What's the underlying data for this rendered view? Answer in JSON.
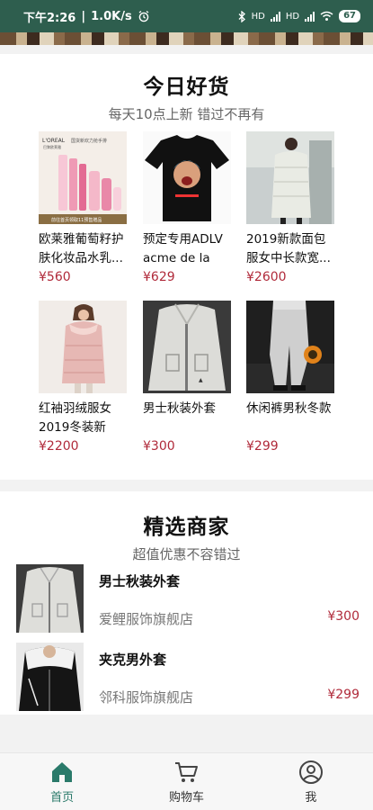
{
  "status_bar": {
    "time": "下午2:26",
    "speed": "1.0K/s",
    "battery": "67",
    "net_hd1": "HD",
    "net_hd2": "HD"
  },
  "section_today": {
    "title": "今日好货",
    "subtitle": "每天10点上新 错过不再有",
    "products": [
      {
        "name": "欧莱雅葡萄籽护肤化妆品水乳...",
        "price": "¥560",
        "image": "cosmetics-ad",
        "ad_brand": "L'OREAL",
        "ad_brand_sub": "巴黎欧莱雅",
        "ad_headline": "国货新欢力抢手排",
        "ad_footer": "前往首页领取11预售赠品"
      },
      {
        "name": "预定专用ADLV acme de la vie...",
        "price": "¥629",
        "image": "black-tshirt"
      },
      {
        "name": "2019新款面包服女中长款宽...",
        "price": "¥2600",
        "image": "white-puffer-coat"
      },
      {
        "name": "红袖羽绒服女2019冬装新款...",
        "price": "¥2200",
        "image": "pink-down-jacket"
      },
      {
        "name": "男士秋装外套",
        "price": "¥300",
        "image": "mens-jacket"
      },
      {
        "name": "休闲裤男秋冬款",
        "price": "¥299",
        "image": "casual-pants"
      }
    ]
  },
  "section_merchants": {
    "title": "精选商家",
    "subtitle": "超值优惠不容错过",
    "merchants": [
      {
        "name": "男士秋装外套",
        "shop": "爱鲤服饰旗舰店",
        "price": "¥300",
        "image": "mens-jacket"
      },
      {
        "name": "夹克男外套",
        "shop": "邻科服饰旗舰店",
        "price": "¥299",
        "image": "black-jacket"
      }
    ]
  },
  "tabbar": {
    "tabs": [
      {
        "label": "首页",
        "icon": "home-icon",
        "active": true
      },
      {
        "label": "购物车",
        "icon": "cart-icon",
        "active": false
      },
      {
        "label": "我",
        "icon": "profile-icon",
        "active": false
      }
    ]
  },
  "colors": {
    "accent": "#2a7a6a",
    "price": "#b02a3a",
    "status_bar": "#2e5e4e"
  }
}
